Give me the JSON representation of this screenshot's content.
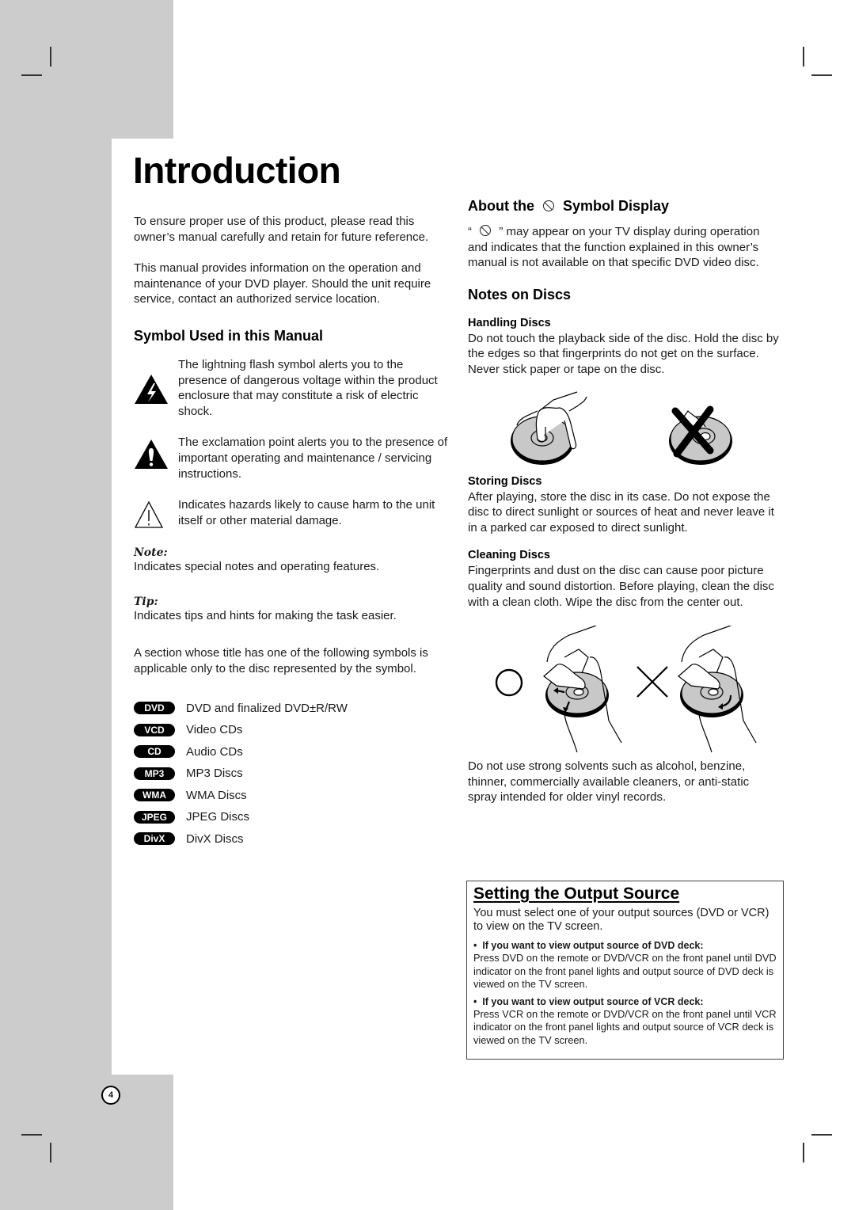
{
  "page": {
    "title": "Introduction",
    "page_number": "4"
  },
  "left": {
    "intro_paragraphs": [
      "To ensure proper use of this product, please read this owner’s manual carefully and retain for future reference.",
      "This manual provides information on the operation and maintenance of your DVD player. Should the unit require service, contact an authorized service location."
    ],
    "symbols_heading": "Symbol Used in this Manual",
    "symbols": [
      {
        "icon": "lightning-warning-icon",
        "text": "The lightning flash symbol alerts you to the presence of dangerous voltage within the product enclosure that may constitute a risk of electric shock."
      },
      {
        "icon": "exclamation-warning-icon",
        "text": "The exclamation point alerts you to the presence of important operating and maintenance / servicing instructions."
      },
      {
        "icon": "caution-outline-icon",
        "text": "Indicates hazards likely to cause harm to the unit itself or other material damage."
      }
    ],
    "note_label": "Note:",
    "note_text": "Indicates special notes and operating features.",
    "tip_label": "Tip:",
    "tip_text": "Indicates tips and hints for making the task easier.",
    "section_symbols_text": "A section whose title has one of the following symbols is applicable only to the disc represented by the symbol.",
    "disc_types": [
      {
        "badge": "DVD",
        "label": "DVD and finalized DVD±R/RW"
      },
      {
        "badge": "VCD",
        "label": "Video CDs"
      },
      {
        "badge": "CD",
        "label": "Audio CDs"
      },
      {
        "badge": "MP3",
        "label": "MP3 Discs"
      },
      {
        "badge": "WMA",
        "label": "WMA Discs"
      },
      {
        "badge": "JPEG",
        "label": "JPEG Discs"
      },
      {
        "badge": "DivX",
        "label": "DivX Discs"
      }
    ]
  },
  "right": {
    "about_heading_pre": "About the",
    "about_heading_post": "Symbol Display",
    "about_text_open": "“",
    "about_text_close": "” may appear on your TV display during operation and indicates that the function explained in this owner’s manual is not available on that specific DVD video disc.",
    "notes_heading": "Notes on Discs",
    "handling_heading": "Handling Discs",
    "handling_text": "Do not touch the playback side of the disc. Hold the disc by the edges so that fingerprints do not get on the surface. Never stick paper or tape on the disc.",
    "storing_heading": "Storing Discs",
    "storing_text": "After playing, store the disc in its case. Do not expose the disc to direct sunlight or sources of heat and never leave it in a parked car exposed to direct sunlight.",
    "cleaning_heading": "Cleaning Discs",
    "cleaning_text": "Fingerprints and dust on the disc can cause poor picture quality and sound distortion. Before playing, clean the disc with a clean cloth. Wipe the disc from the center out.",
    "solvent_text": "Do not use strong solvents such as alcohol, benzine, thinner, commercially available cleaners, or anti-static spray intended for older vinyl records."
  },
  "output_source": {
    "heading": "Setting the Output Source",
    "intro": "You must select one of your output sources (DVD or VCR) to view on the TV screen.",
    "items": [
      {
        "bullet": "If you want to view output source of DVD deck:",
        "text": "Press DVD on the remote or DVD/VCR on the front panel until DVD indicator on the front panel lights and output source of DVD deck is viewed on the TV screen."
      },
      {
        "bullet": "If you want to view output source of VCR deck:",
        "text": "Press VCR on the remote or DVD/VCR on the front panel until VCR indicator on the front panel lights and output source of VCR deck is viewed on the TV screen."
      }
    ]
  }
}
